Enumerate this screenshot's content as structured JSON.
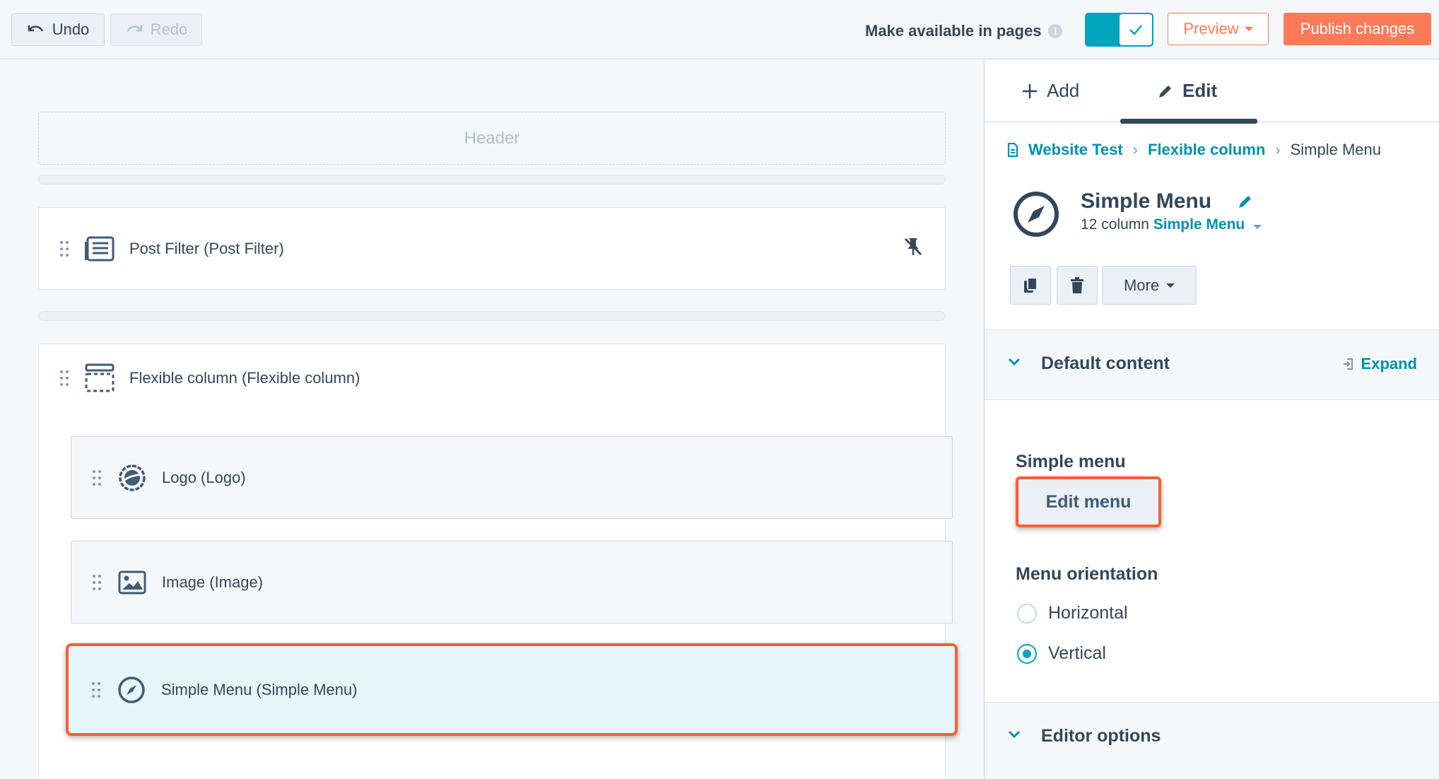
{
  "toolbar": {
    "undo_label": "Undo",
    "redo_label": "Redo",
    "availability_label": "Make available in pages",
    "preview_label": "Preview",
    "publish_label": "Publish changes",
    "available_toggle_on": true
  },
  "canvas": {
    "header_label": "Header",
    "modules": [
      {
        "label": "Post Filter (Post Filter)",
        "icon": "post-filter-icon"
      },
      {
        "label": "Flexible column (Flexible column)",
        "icon": "flexible-column-icon"
      }
    ],
    "children": [
      {
        "label": "Logo (Logo)",
        "icon": "logo-icon"
      },
      {
        "label": "Image (Image)",
        "icon": "image-icon"
      },
      {
        "label": "Simple Menu (Simple Menu)",
        "icon": "compass-icon",
        "selected": true
      }
    ]
  },
  "panel": {
    "tabs": [
      {
        "label": "Add",
        "icon": "plus-icon"
      },
      {
        "label": "Edit",
        "icon": "pencil-icon",
        "active": true
      }
    ],
    "breadcrumb": [
      "Website Test",
      "Flexible column",
      "Simple Menu"
    ],
    "module_title": "Simple Menu",
    "module_sub_prefix": "12 column",
    "module_sub_link": "Simple Menu",
    "more_label": "More",
    "sections": {
      "default_content": "Default content",
      "expand_label": "Expand",
      "editor_options": "Editor options"
    },
    "simple_menu_label": "Simple menu",
    "edit_menu_label": "Edit menu",
    "orientation_label": "Menu orientation",
    "orientation_options": [
      "Horizontal",
      "Vertical"
    ],
    "orientation_selected": "Vertical"
  },
  "colors": {
    "accent": "#00a4bd",
    "brand": "#ff7a59",
    "highlight": "#ff5c35",
    "link": "#0091ae",
    "text": "#33475b"
  }
}
